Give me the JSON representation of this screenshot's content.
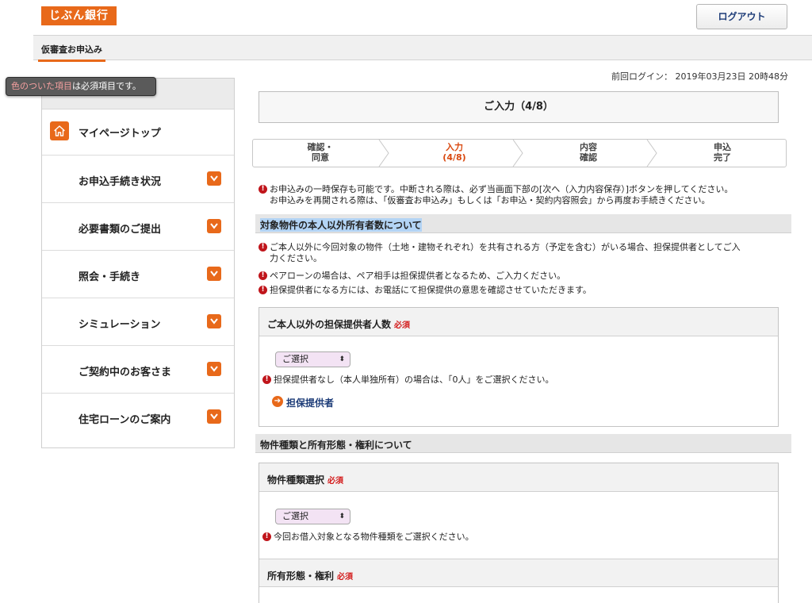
{
  "brand": {
    "logo": "じぶん銀行"
  },
  "header": {
    "logout": "ログアウト"
  },
  "subnav": {
    "tab": "仮審査お申込み"
  },
  "last_login": "前回ログイン： 2019年03月23日 20時48分",
  "tooltip": {
    "accent": "色のついた項目",
    "rest": "は必須項目です。"
  },
  "sidebar": {
    "mypage": "マイページトップ",
    "items": [
      {
        "label": "お申込手続き状況"
      },
      {
        "label": "必要書類のご提出"
      },
      {
        "label": "照会・手続き"
      },
      {
        "label": "シミュレーション"
      },
      {
        "label": "ご契約中のお客さま"
      },
      {
        "label": "住宅ローンのご案内"
      }
    ]
  },
  "page_title": "ご入力（4/8）",
  "steps": [
    {
      "line1": "確認・",
      "line2": "同意"
    },
    {
      "line1": "入力",
      "line2": "(4/8)"
    },
    {
      "line1": "内容",
      "line2": "確認"
    },
    {
      "line1": "申込",
      "line2": "完了"
    }
  ],
  "notice_top": {
    "line1": "お申込みの一時保存も可能です。中断される際は、必ず当画面下部の[次へ（入力内容保存）]ボタンを押してください。",
    "line2": "お申込みを再開される際は、「仮審査お申込み」もしくは「お申込・契約内容照会」から再度お手続きください。"
  },
  "section1": {
    "title": "対象物件の本人以外所有者数について",
    "note1a": "ご本人以外に今回対象の物件（土地・建物それぞれ）を共有される方（予定を含む）がいる場合、担保提供者としてご入",
    "note1b": "力ください。",
    "note2": "ペアローンの場合は、ペア相手は担保提供者となるため、ご入力ください。",
    "note3": "担保提供者になる方には、お電話にて担保提供の意思を確認させていただきます。"
  },
  "box1": {
    "title": "ご本人以外の担保提供者人数",
    "required": "必須",
    "select": "ご選択",
    "note": "担保提供者なし（本人単独所有）の場合は、「0人」をご選択ください。",
    "link": "担保提供者"
  },
  "section2": {
    "title": "物件種類と所有形態・権利について"
  },
  "box2": {
    "title": "物件種類選択",
    "required": "必須",
    "select": "ご選択",
    "note": "今回お借入対象となる物件種類をご選択ください。"
  },
  "box3": {
    "title": "所有形態・権利",
    "required": "必須"
  },
  "colors": {
    "accent": "#e8691a",
    "link": "#1d3c78",
    "warn": "#c0151b"
  },
  "icons": [
    "home-icon",
    "chevron-down-icon",
    "warning-icon",
    "arrow-right-circle-icon"
  ]
}
